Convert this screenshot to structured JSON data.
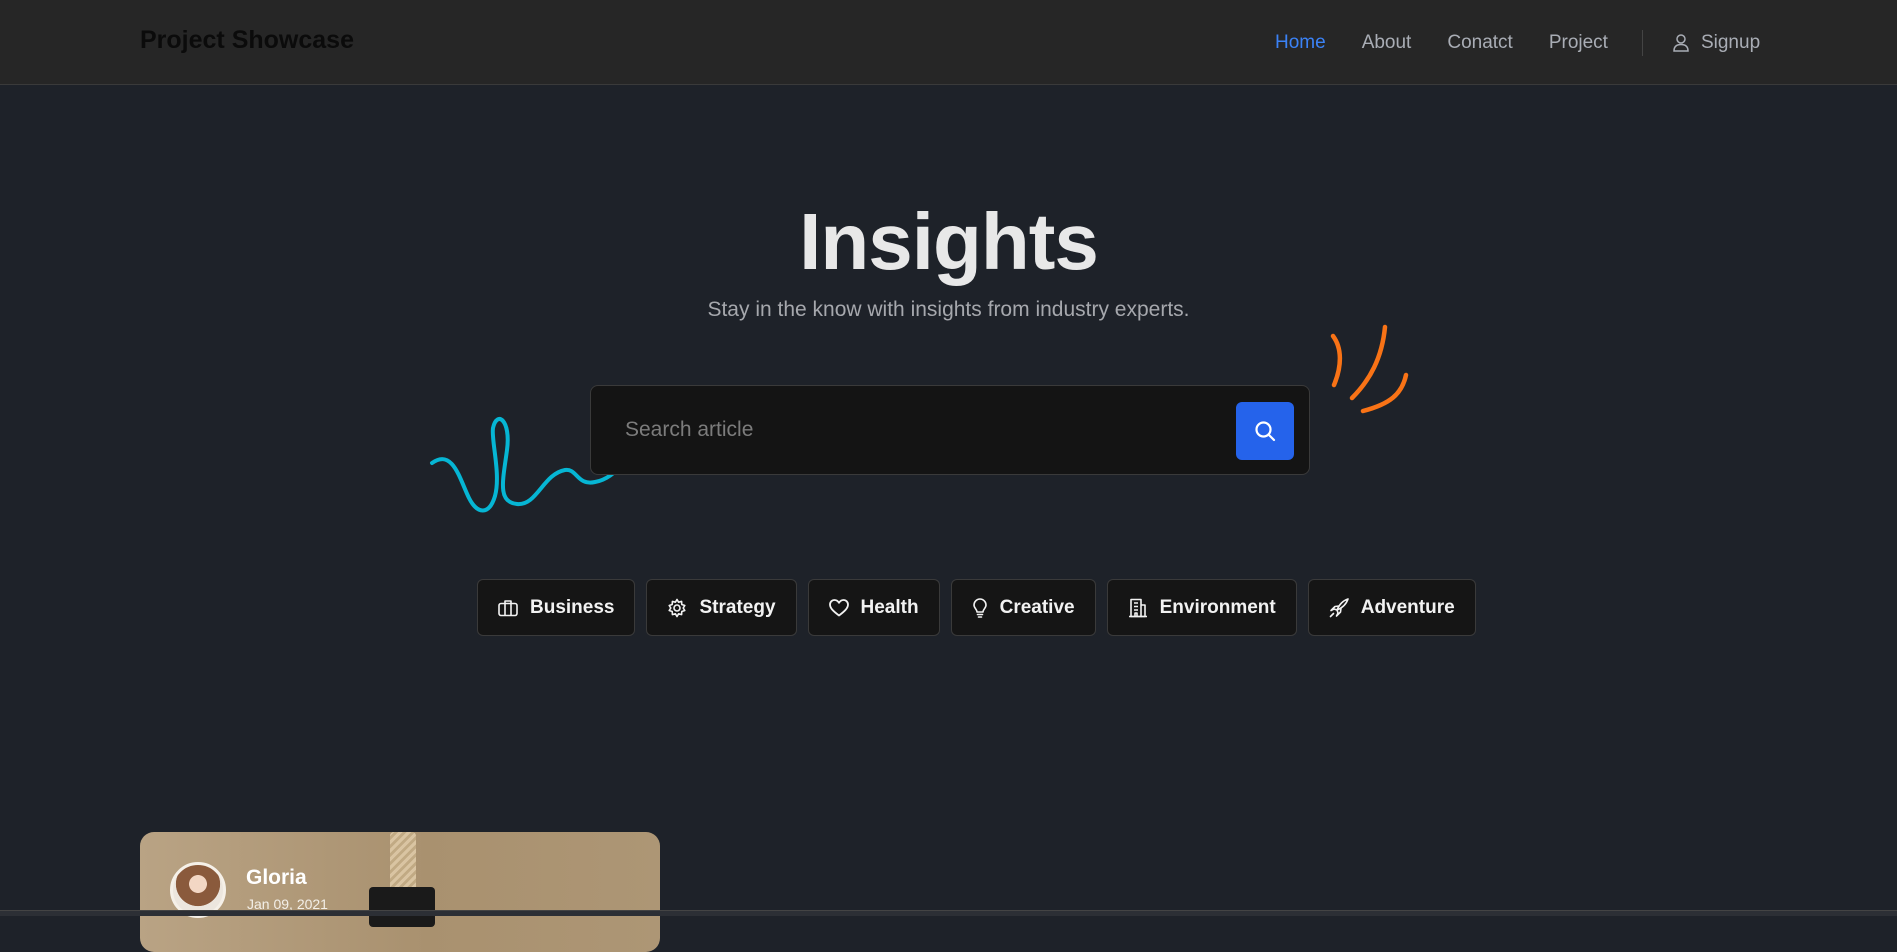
{
  "navbar": {
    "brand": "Project Showcase",
    "links": [
      {
        "label": "Home",
        "active": true
      },
      {
        "label": "About",
        "active": false
      },
      {
        "label": "Conatct",
        "active": false
      },
      {
        "label": "Project",
        "active": false
      }
    ],
    "signup_label": "Signup",
    "signup_icon": "user-icon"
  },
  "hero": {
    "title": "Insights",
    "subtitle": "Stay in the know with insights from industry experts."
  },
  "search": {
    "placeholder": "Search article",
    "value": "",
    "button_icon": "search-icon"
  },
  "categories": [
    {
      "label": "Business",
      "icon": "briefcase-icon"
    },
    {
      "label": "Strategy",
      "icon": "gear-icon"
    },
    {
      "label": "Health",
      "icon": "heart-icon"
    },
    {
      "label": "Creative",
      "icon": "lightbulb-icon"
    },
    {
      "label": "Environment",
      "icon": "building-icon"
    },
    {
      "label": "Adventure",
      "icon": "rocket-icon"
    }
  ],
  "article_card": {
    "author": "Gloria",
    "date": "Jan 09, 2021"
  },
  "colors": {
    "accent": "#2563eb",
    "active_link": "#3b82f6",
    "squiggle_blue": "#06b6d4",
    "squiggle_orange": "#f97316",
    "background": "#1e2229",
    "navbar": "#262626"
  }
}
